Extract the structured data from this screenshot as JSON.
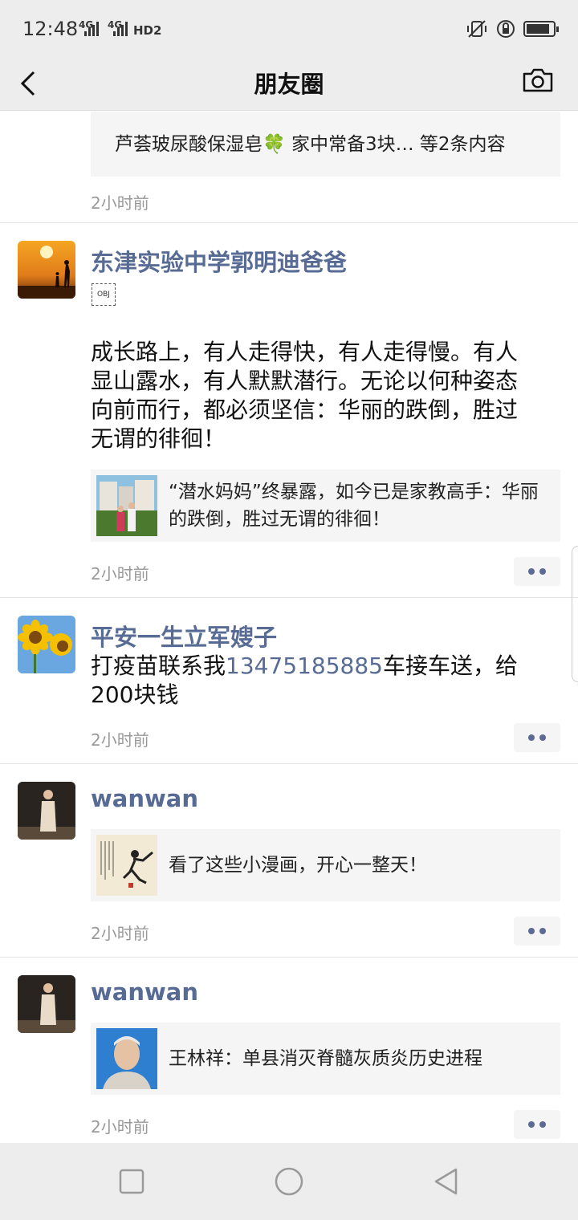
{
  "status_bar": {
    "time": "12:48",
    "network_1": "4G",
    "network_2": "4G",
    "hd": "HD2",
    "battery_level": 0.9
  },
  "navbar": {
    "title": "朋友圈",
    "back_icon": "chevron-left-icon",
    "camera_icon": "camera-icon"
  },
  "posts": [
    {
      "link_title": "芦荟玻尿酸保湿皂🍀 家中常备3块… 等2条内容",
      "time": "2小时前"
    },
    {
      "author": "东津实验中学郭明迪爸爸",
      "obj_label": "OBJ",
      "text": "成长路上，有人走得快，有人走得慢。有人显山露水，有人默默潜行。无论以何种姿态向前而行，都必须坚信：华丽的跌倒，胜过无谓的徘徊！",
      "link_title": "“潜水妈妈”终暴露，如今已是家教高手：华丽的跌倒，胜过无谓的徘徊！",
      "time": "2小时前"
    },
    {
      "author": "平安一生立军嫂子",
      "text_before": "打疫苗联系我",
      "phone": "13475185885",
      "text_after": "车接车送，给200块钱",
      "time": "2小时前"
    },
    {
      "author": "wanwan",
      "link_title": "看了这些小漫画，开心一整天！",
      "time": "2小时前"
    },
    {
      "author": "wanwan",
      "link_title": "王林祥：单县消灭脊髓灰质炎历史进程",
      "time": "2小时前"
    }
  ],
  "colors": {
    "author": "#576b95",
    "bar_bg": "#ededed",
    "card_bg": "#f5f5f5",
    "time": "#999999"
  }
}
